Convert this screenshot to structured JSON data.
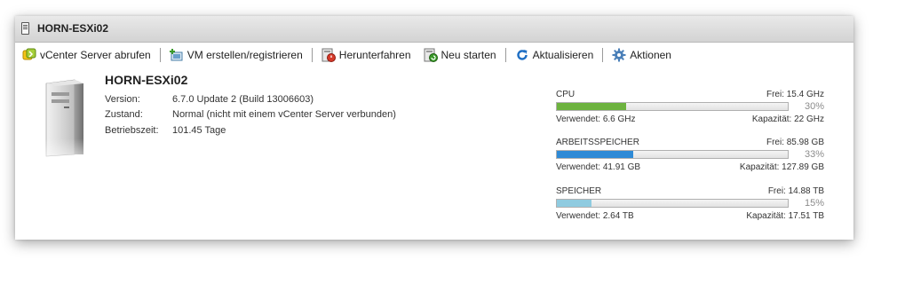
{
  "titlebar": {
    "title": "HORN-ESXi02"
  },
  "toolbar": {
    "items": [
      {
        "label": "vCenter Server abrufen",
        "icon": "vcenter-icon"
      },
      {
        "label": "VM erstellen/registrieren",
        "icon": "create-vm-icon"
      },
      {
        "label": "Herunterfahren",
        "icon": "shutdown-icon"
      },
      {
        "label": "Neu starten",
        "icon": "restart-icon"
      },
      {
        "label": "Aktualisieren",
        "icon": "refresh-icon"
      },
      {
        "label": "Aktionen",
        "icon": "gear-icon"
      }
    ]
  },
  "host": {
    "name": "HORN-ESXi02",
    "icon": "server-icon",
    "properties": [
      {
        "label": "Version:",
        "value": "6.7.0 Update 2 (Build 13006603)"
      },
      {
        "label": "Zustand:",
        "value": "Normal (nicht mit einem vCenter Server verbunden)"
      },
      {
        "label": "Betriebszeit:",
        "value": "101.45 Tage"
      }
    ]
  },
  "resources": [
    {
      "name": "CPU",
      "free": "Frei: 15.4 GHz",
      "percent": "30%",
      "fraction": 0.3,
      "used": "Verwendet: 6.6 GHz",
      "capacity": "Kapazität: 22 GHz",
      "color": "#6db33f"
    },
    {
      "name": "ARBEITSSPEICHER",
      "free": "Frei: 85.98 GB",
      "percent": "33%",
      "fraction": 0.33,
      "used": "Verwendet: 41.91 GB",
      "capacity": "Kapazität: 127.89 GB",
      "color": "#2e8ad6"
    },
    {
      "name": "SPEICHER",
      "free": "Frei: 14.88 TB",
      "percent": "15%",
      "fraction": 0.15,
      "used": "Verwendet: 2.64 TB",
      "capacity": "Kapazität: 17.51 TB",
      "color": "#8fcbe0"
    }
  ]
}
